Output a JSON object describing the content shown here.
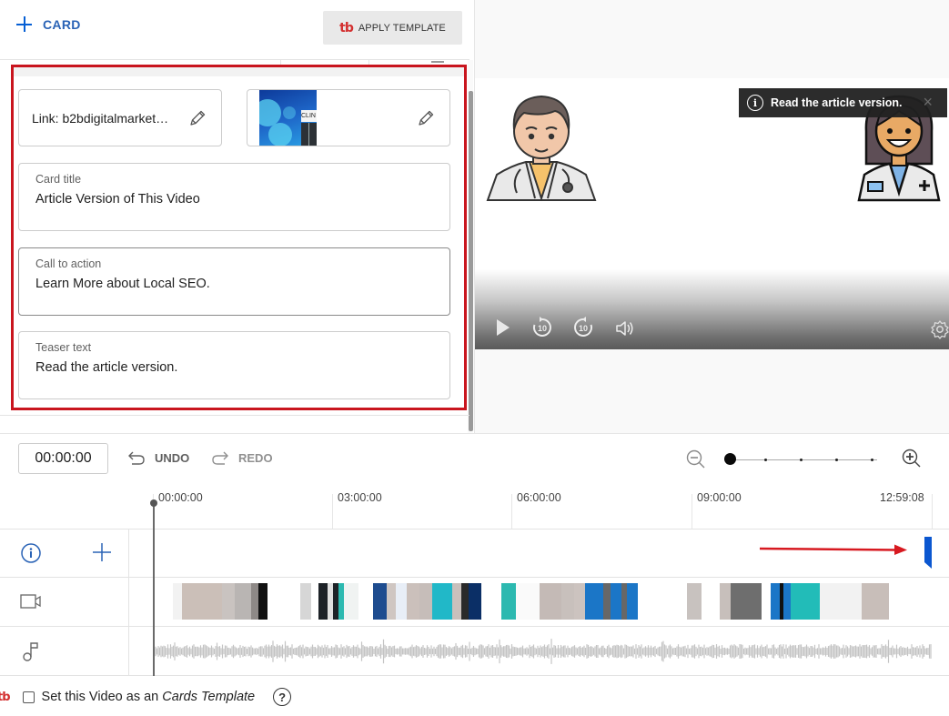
{
  "toolbar": {
    "add_card_label": "CARD",
    "add_card_icon": "plus-icon",
    "apply_template_label": "APPLY TEMPLATE",
    "brand_logo_text": "tb"
  },
  "card_editor": {
    "link": {
      "value": "Link: b2bdigitalmarket…",
      "edit_icon": "pencil-icon"
    },
    "image": {
      "sign_text": "CLIN",
      "edit_icon": "pencil-icon"
    },
    "card_title": {
      "label": "Card title",
      "value": "Article Version of This Video"
    },
    "call_to_action": {
      "label": "Call to action",
      "value": "Learn More about Local SEO."
    },
    "teaser_text": {
      "label": "Teaser text",
      "value": "Read the article version."
    }
  },
  "preview": {
    "teaser_overlay_text": "Read the article version.",
    "teaser_icon": "info-icon",
    "close_glyph": "×",
    "controls": [
      "play-icon",
      "rewind-10-icon",
      "forward-10-icon",
      "volume-icon",
      "settings-icon"
    ],
    "rewind_label": "10",
    "forward_label": "10"
  },
  "timeline": {
    "current_time": "00:00:00",
    "undo_label": "UNDO",
    "redo_label": "REDO",
    "zoom_level_index": 0,
    "zoom_steps": 5,
    "ruler": [
      "00:00:00",
      "03:00:00",
      "06:00:00",
      "09:00:00",
      "12:59:08"
    ],
    "tracks": [
      {
        "name": "cards",
        "icon": "info-icon",
        "add_icon": "plus-icon"
      },
      {
        "name": "video",
        "icon": "video-camera-icon"
      },
      {
        "name": "audio",
        "icon": "music-note-icon"
      }
    ],
    "card_marker_position": "end"
  },
  "footer": {
    "brand_logo_text": "tb",
    "checkbox_checked": false,
    "text_prefix": "Set this Video as an ",
    "text_emphasis": "Cards Template",
    "help_glyph": "?"
  },
  "colors": {
    "accent_blue": "#065fd4",
    "highlight_red": "#c9151e",
    "brand_red": "#d32f2f",
    "marker_blue": "#0b57d0"
  }
}
